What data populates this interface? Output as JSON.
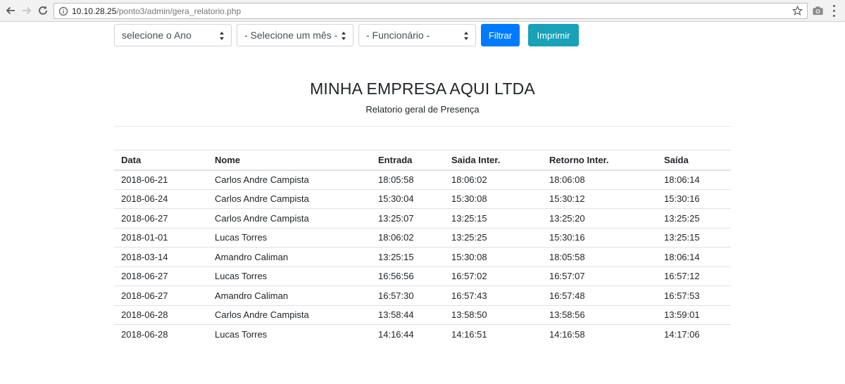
{
  "browser": {
    "url_host": "10.10.28.25",
    "url_path": "/ponto3/admin/gera_relatorio.php",
    "icons": [
      "back-icon",
      "forward-icon",
      "reload-icon",
      "info-icon",
      "star-icon",
      "camera-icon",
      "menu-icon"
    ]
  },
  "filters": {
    "year_select": "selecione o Ano",
    "month_select": "- Selecione um mês -",
    "employee_select": "- Funcionário -",
    "filter_button": "Filtrar",
    "print_button": "Imprimir"
  },
  "colors": {
    "primary": "#007bff",
    "info": "#17a2b8"
  },
  "report": {
    "company": "MINHA EMPRESA AQUI LTDA",
    "subtitle": "Relatorio geral de Presença"
  },
  "table": {
    "headers": [
      "Data",
      "Nome",
      "Entrada",
      "Saida Inter.",
      "Retorno Inter.",
      "Saída"
    ],
    "rows": [
      [
        "2018-06-21",
        "Carlos Andre Campista",
        "18:05:58",
        "18:06:02",
        "18:06:08",
        "18:06:14"
      ],
      [
        "2018-06-24",
        "Carlos Andre Campista",
        "15:30:04",
        "15:30:08",
        "15:30:12",
        "15:30:16"
      ],
      [
        "2018-06-27",
        "Carlos Andre Campista",
        "13:25:07",
        "13:25:15",
        "13:25:20",
        "13:25:25"
      ],
      [
        "2018-01-01",
        "Lucas Torres",
        "18:06:02",
        "13:25:25",
        "15:30:16",
        "13:25:15"
      ],
      [
        "2018-03-14",
        "Amandro Caliman",
        "13:25:15",
        "15:30:08",
        "18:05:58",
        "18:06:14"
      ],
      [
        "2018-06-27",
        "Lucas Torres",
        "16:56:56",
        "16:57:02",
        "16:57:07",
        "16:57:12"
      ],
      [
        "2018-06-27",
        "Amandro Caliman",
        "16:57:30",
        "16:57:43",
        "16:57:48",
        "16:57:53"
      ],
      [
        "2018-06-28",
        "Carlos Andre Campista",
        "13:58:44",
        "13:58:50",
        "13:58:56",
        "13:59:01"
      ],
      [
        "2018-06-28",
        "Lucas Torres",
        "14:16:44",
        "14:16:51",
        "14:16:58",
        "14:17:06"
      ]
    ]
  }
}
